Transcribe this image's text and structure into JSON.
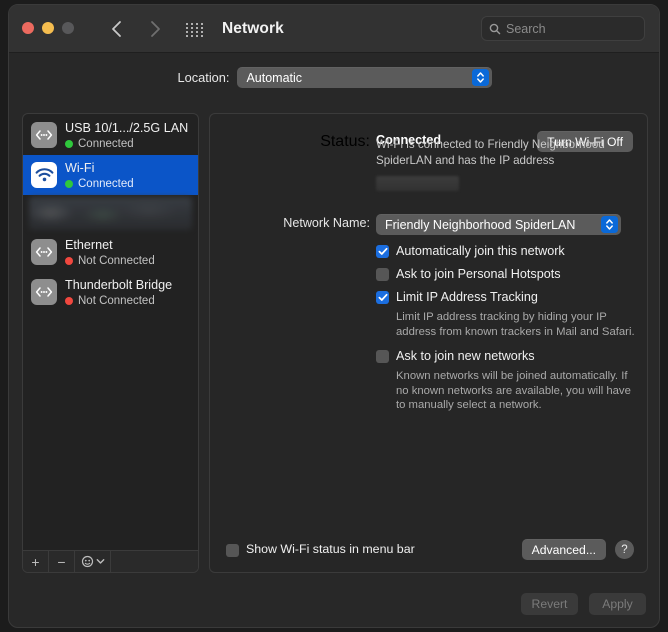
{
  "window": {
    "title": "Network",
    "traffic_lights": [
      "close",
      "minimize",
      "zoom"
    ],
    "back_label": "Back",
    "forward_label": "Forward",
    "grid_label": "Show All Preferences"
  },
  "search": {
    "placeholder": "Search",
    "value": ""
  },
  "location": {
    "label": "Location:",
    "selected": "Automatic"
  },
  "sidebar": {
    "items": [
      {
        "name": "USB 10/1.../2.5G LAN",
        "status": "Connected",
        "state": "connected",
        "icon": "ethernet-icon",
        "selected": false
      },
      {
        "name": "Wi-Fi",
        "status": "Connected",
        "state": "connected",
        "icon": "wifi-icon",
        "selected": true
      },
      {
        "name": "",
        "status": "",
        "state": "redacted",
        "icon": "redacted",
        "selected": false
      },
      {
        "name": "Ethernet",
        "status": "Not Connected",
        "state": "disconnected",
        "icon": "ethernet-icon",
        "selected": false
      },
      {
        "name": "Thunderbolt Bridge",
        "status": "Not Connected",
        "state": "disconnected",
        "icon": "ethernet-icon",
        "selected": false
      }
    ],
    "footer": {
      "add_label": "+",
      "remove_label": "−",
      "action_label": "Action"
    }
  },
  "detail": {
    "status_label": "Status:",
    "status_value": "Connected",
    "wifi_toggle_label": "Turn Wi-Fi Off",
    "status_description": "Wi-Fi is connected to Friendly Neighborhood SpiderLAN and has the IP address",
    "ip_address": "",
    "network_name_label": "Network Name:",
    "network_name_value": "Friendly Neighborhood SpiderLAN",
    "checkboxes": [
      {
        "label": "Automatically join this network",
        "checked": true,
        "help": ""
      },
      {
        "label": "Ask to join Personal Hotspots",
        "checked": false,
        "help": ""
      },
      {
        "label": "Limit IP Address Tracking",
        "checked": true,
        "help": "Limit IP address tracking by hiding your IP address from known trackers in Mail and Safari."
      },
      {
        "label": "Ask to join new networks",
        "checked": false,
        "help": "Known networks will be joined automatically. If no known networks are available, you will have to manually select a network."
      }
    ],
    "menu_bar_checkbox": {
      "label": "Show Wi-Fi status in menu bar",
      "checked": false
    },
    "advanced_label": "Advanced...",
    "help_label": "?"
  },
  "footer": {
    "revert_label": "Revert",
    "apply_label": "Apply"
  },
  "colors": {
    "accent": "#0b55c8",
    "connected": "#2fc83c",
    "disconnected": "#f1483f",
    "window_bg": "#282828"
  }
}
